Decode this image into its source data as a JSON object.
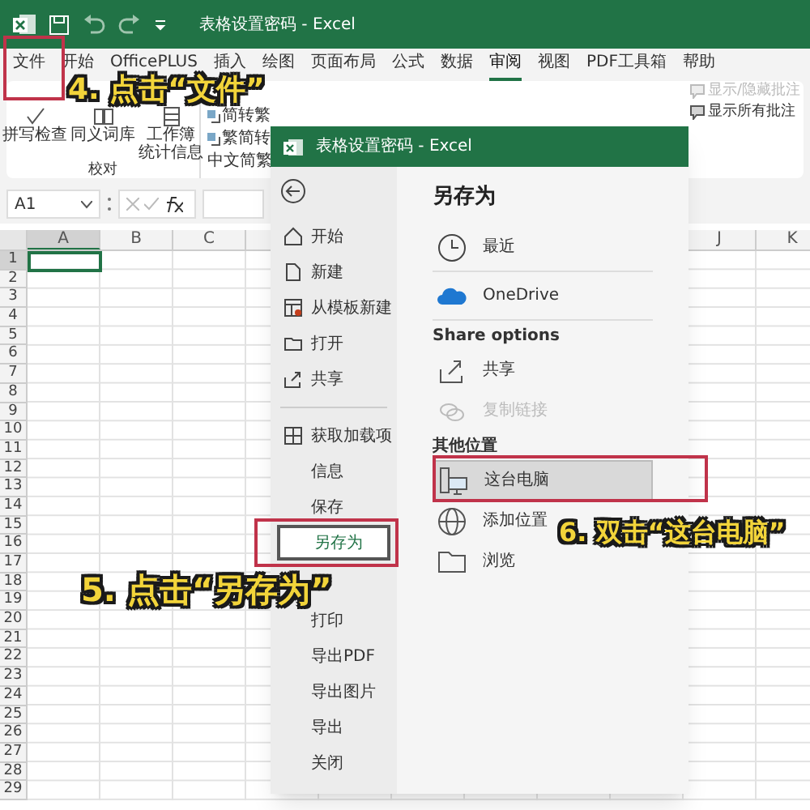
{
  "window": {
    "title": "表格设置密码 - Excel"
  },
  "tabs": [
    {
      "label": "文件",
      "selected": false
    },
    {
      "label": "开始",
      "selected": false
    },
    {
      "label": "OfficePLUS",
      "selected": false
    },
    {
      "label": "插入",
      "selected": false
    },
    {
      "label": "绘图",
      "selected": false
    },
    {
      "label": "页面布局",
      "selected": false
    },
    {
      "label": "公式",
      "selected": false
    },
    {
      "label": "数据",
      "selected": false
    },
    {
      "label": "审阅",
      "selected": true
    },
    {
      "label": "视图",
      "selected": false
    },
    {
      "label": "PDF工具箱",
      "selected": false
    },
    {
      "label": "帮助",
      "selected": false
    }
  ],
  "ribbon": {
    "proofing": {
      "buttons": [
        [
          "拼写检查"
        ],
        [
          "同义词库"
        ],
        [
          "工作簿",
          "统计信息"
        ]
      ],
      "group_label": "校对"
    },
    "chinese": {
      "buttons": [
        "简转繁",
        "繁简转"
      ],
      "group_label": "中文简繁"
    },
    "comments": [
      {
        "label": "显示/隐藏批注",
        "disabled": true
      },
      {
        "label": "显示所有批注",
        "disabled": false
      }
    ]
  },
  "formula_bar": {
    "name_box": "A1"
  },
  "grid": {
    "columns": [
      "A",
      "B",
      "C",
      "J",
      "K"
    ],
    "rows": [
      "1",
      "2",
      "3",
      "4",
      "5",
      "6",
      "7",
      "8",
      "9",
      "10",
      "11",
      "12",
      "13",
      "14",
      "15",
      "16",
      "17",
      "18",
      "19",
      "20",
      "21",
      "22",
      "23",
      "24",
      "25",
      "26",
      "27",
      "28",
      "29"
    ]
  },
  "backstage": {
    "title": "表格设置密码 - Excel",
    "nav": [
      [
        {
          "label": "开始",
          "selected": false
        },
        {
          "label": "新建",
          "selected": false
        },
        {
          "label": "从模板新建",
          "selected": false
        },
        {
          "label": "打开",
          "selected": false
        },
        {
          "label": "共享",
          "selected": false
        }
      ],
      [
        {
          "label": "获取加载项",
          "selected": false
        },
        {
          "label": "信息",
          "selected": false
        },
        {
          "label": "保存",
          "selected": false
        },
        {
          "label": "另存为",
          "selected": true
        },
        {
          "label": "打印",
          "selected": false
        },
        {
          "label": "导出PDF",
          "selected": false
        },
        {
          "label": "导出图片",
          "selected": false
        },
        {
          "label": "导出",
          "selected": false
        },
        {
          "label": "关闭",
          "selected": false
        }
      ]
    ],
    "heading": "另存为",
    "items": [
      {
        "kind": "location",
        "label": "最近",
        "selected": false,
        "disabled": false
      },
      {
        "kind": "location",
        "label": "OneDrive",
        "selected": false,
        "disabled": false
      },
      {
        "kind": "section",
        "label": "Share options"
      },
      {
        "kind": "location",
        "label": "共享",
        "selected": false,
        "disabled": false
      },
      {
        "kind": "location",
        "label": "复制链接",
        "selected": false,
        "disabled": true
      },
      {
        "kind": "section",
        "label": "其他位置"
      },
      {
        "kind": "location",
        "label": "这台电脑",
        "selected": true,
        "disabled": false
      },
      {
        "kind": "location",
        "label": "添加位置",
        "selected": false,
        "disabled": false
      },
      {
        "kind": "location",
        "label": "浏览",
        "selected": false,
        "disabled": false
      }
    ]
  },
  "annotations": [
    "4. 点击“文件”",
    "5. 点击“另存为”",
    "6. 双击“这台电脑”"
  ]
}
